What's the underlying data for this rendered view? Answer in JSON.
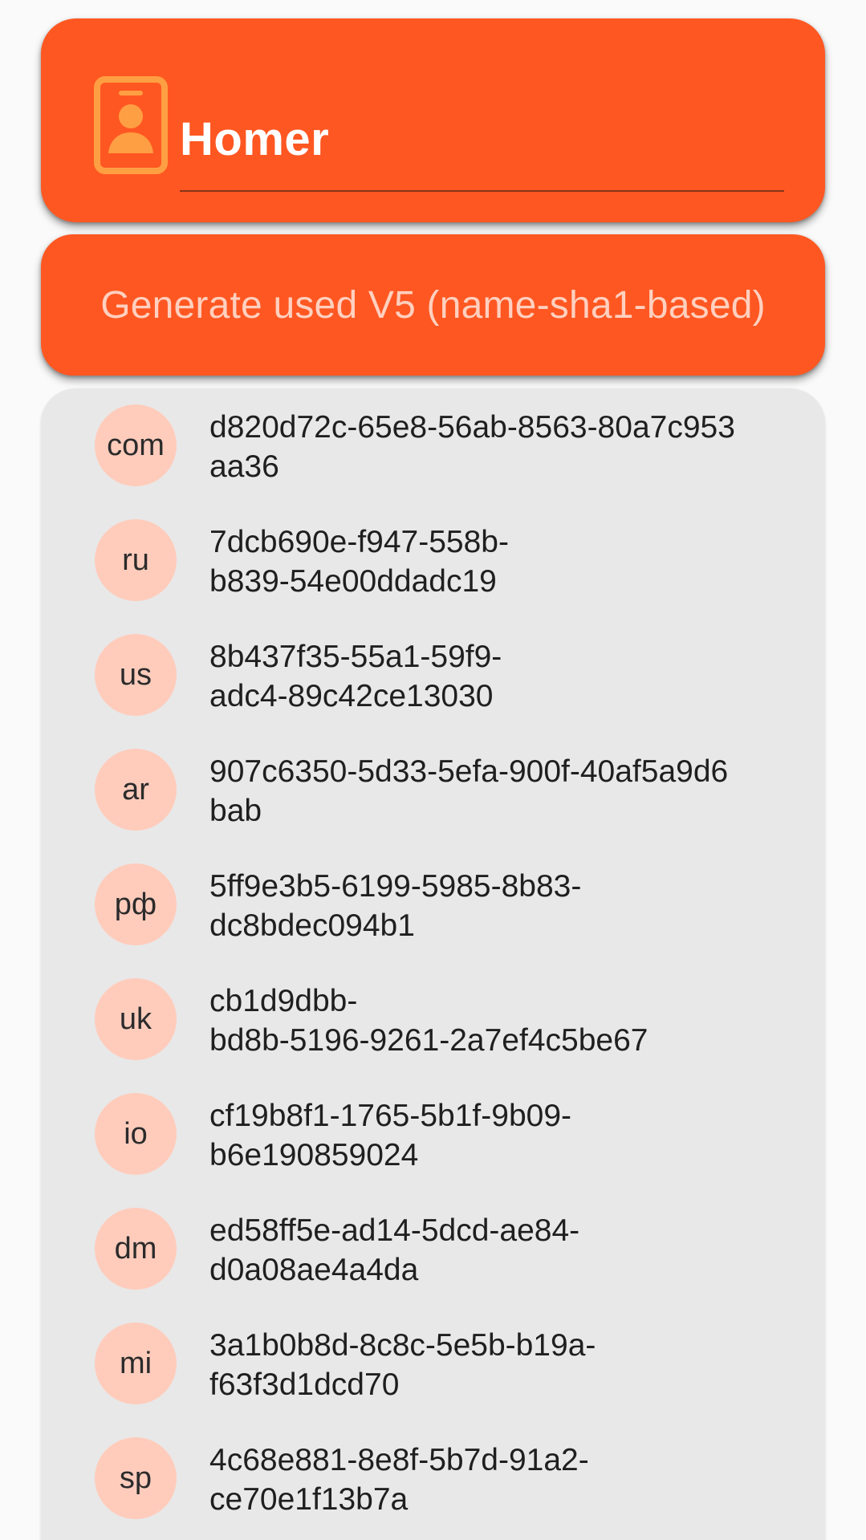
{
  "header": {
    "icon": "contact-badge-icon",
    "name_value": "Homer"
  },
  "actions": {
    "generate_label": "Generate used V5 (name-sha1-based)"
  },
  "results": [
    {
      "tld": "com",
      "uuid": "d820d72c-65e8-56ab-8563-80a7c953\naa36"
    },
    {
      "tld": "ru",
      "uuid": "7dcb690e-f947-558b-\nb839-54e00ddadc19"
    },
    {
      "tld": "us",
      "uuid": "8b437f35-55a1-59f9-\nadc4-89c42ce13030"
    },
    {
      "tld": "ar",
      "uuid": "907c6350-5d33-5efa-900f-40af5a9d6\nbab"
    },
    {
      "tld": "рф",
      "uuid": "5ff9e3b5-6199-5985-8b83-\ndc8bdec094b1"
    },
    {
      "tld": "uk",
      "uuid": "cb1d9dbb-\nbd8b-5196-9261-2a7ef4c5be67"
    },
    {
      "tld": "io",
      "uuid": "cf19b8f1-1765-5b1f-9b09-\nb6e190859024"
    },
    {
      "tld": "dm",
      "uuid": "ed58ff5e-ad14-5dcd-ae84-\nd0a08ae4a4da"
    },
    {
      "tld": "mi",
      "uuid": "3a1b0b8d-8c8c-5e5b-b19a-\nf63f3d1dcd70"
    },
    {
      "tld": "sp",
      "uuid": "4c68e881-8e8f-5b7d-91a2-\nce70e1f13b7a"
    }
  ],
  "colors": {
    "primary": "#ff5722",
    "icon_orange": "#ff9f43",
    "avatar_bg": "#ffccbc",
    "list_bg": "#e8e8e8",
    "button_text": "#ffd0bf"
  }
}
